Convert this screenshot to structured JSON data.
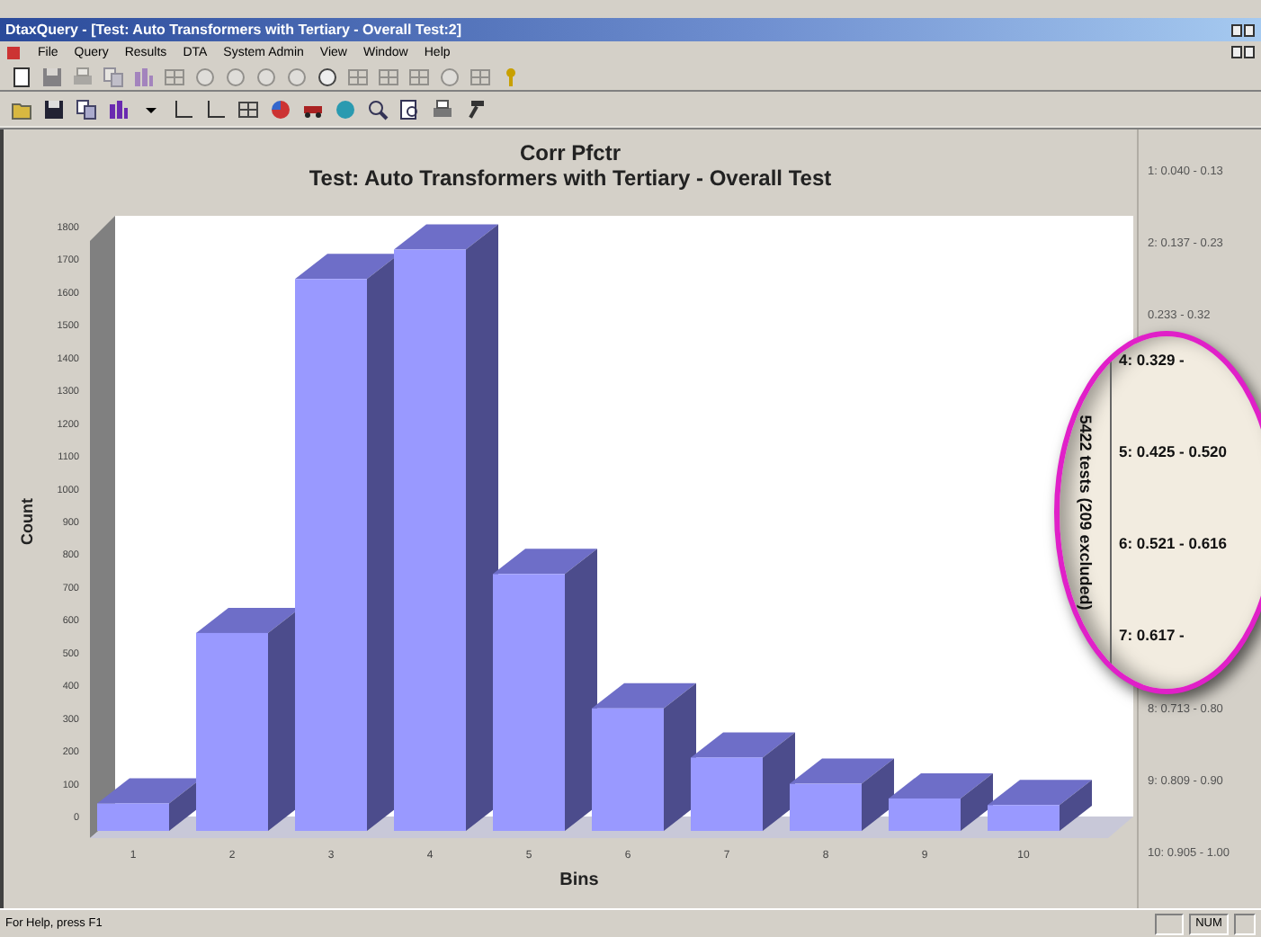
{
  "window": {
    "title": "DtaxQuery - [Test: Auto Transformers with Tertiary - Overall Test:2]"
  },
  "menu": [
    "File",
    "Query",
    "Results",
    "DTA",
    "System Admin",
    "View",
    "Window",
    "Help"
  ],
  "chart": {
    "subtitle": "Test: Auto Transformers with Tertiary - Overall Test",
    "chart_data": {
      "type": "bar",
      "title": "Corr Pfctr",
      "xlabel": "Bins",
      "ylabel": "Count",
      "categories": [
        "1",
        "2",
        "3",
        "4",
        "5",
        "6",
        "7",
        "8",
        "9",
        "10"
      ],
      "series": [
        {
          "color": "#9999ff",
          "values": [
            40,
            560,
            1640,
            1730,
            740,
            330,
            180,
            100,
            55,
            35
          ]
        }
      ],
      "ylim": [
        0,
        1800
      ],
      "yticks": [
        0,
        100,
        200,
        300,
        400,
        500,
        600,
        700,
        800,
        900,
        1000,
        1100,
        1200,
        1300,
        1400,
        1500,
        1600,
        1700,
        1800
      ]
    }
  },
  "legend": {
    "top": [
      "1: 0.040 - 0.13",
      "2: 0.137 - 0.23",
      "0.233 - 0.32"
    ],
    "bottom": [
      "8: 0.713 - 0.80",
      "9: 0.809 - 0.90",
      "10: 0.905 - 1.00"
    ]
  },
  "callout": {
    "caption": "5422 tests (209 excluded)",
    "entries": [
      "4: 0.329 -",
      "5: 0.425 - 0.520",
      "6: 0.521 - 0.616",
      "7: 0.617 -"
    ]
  },
  "status_bar": {
    "message": "For Help, press F1",
    "indicator": "NUM"
  }
}
